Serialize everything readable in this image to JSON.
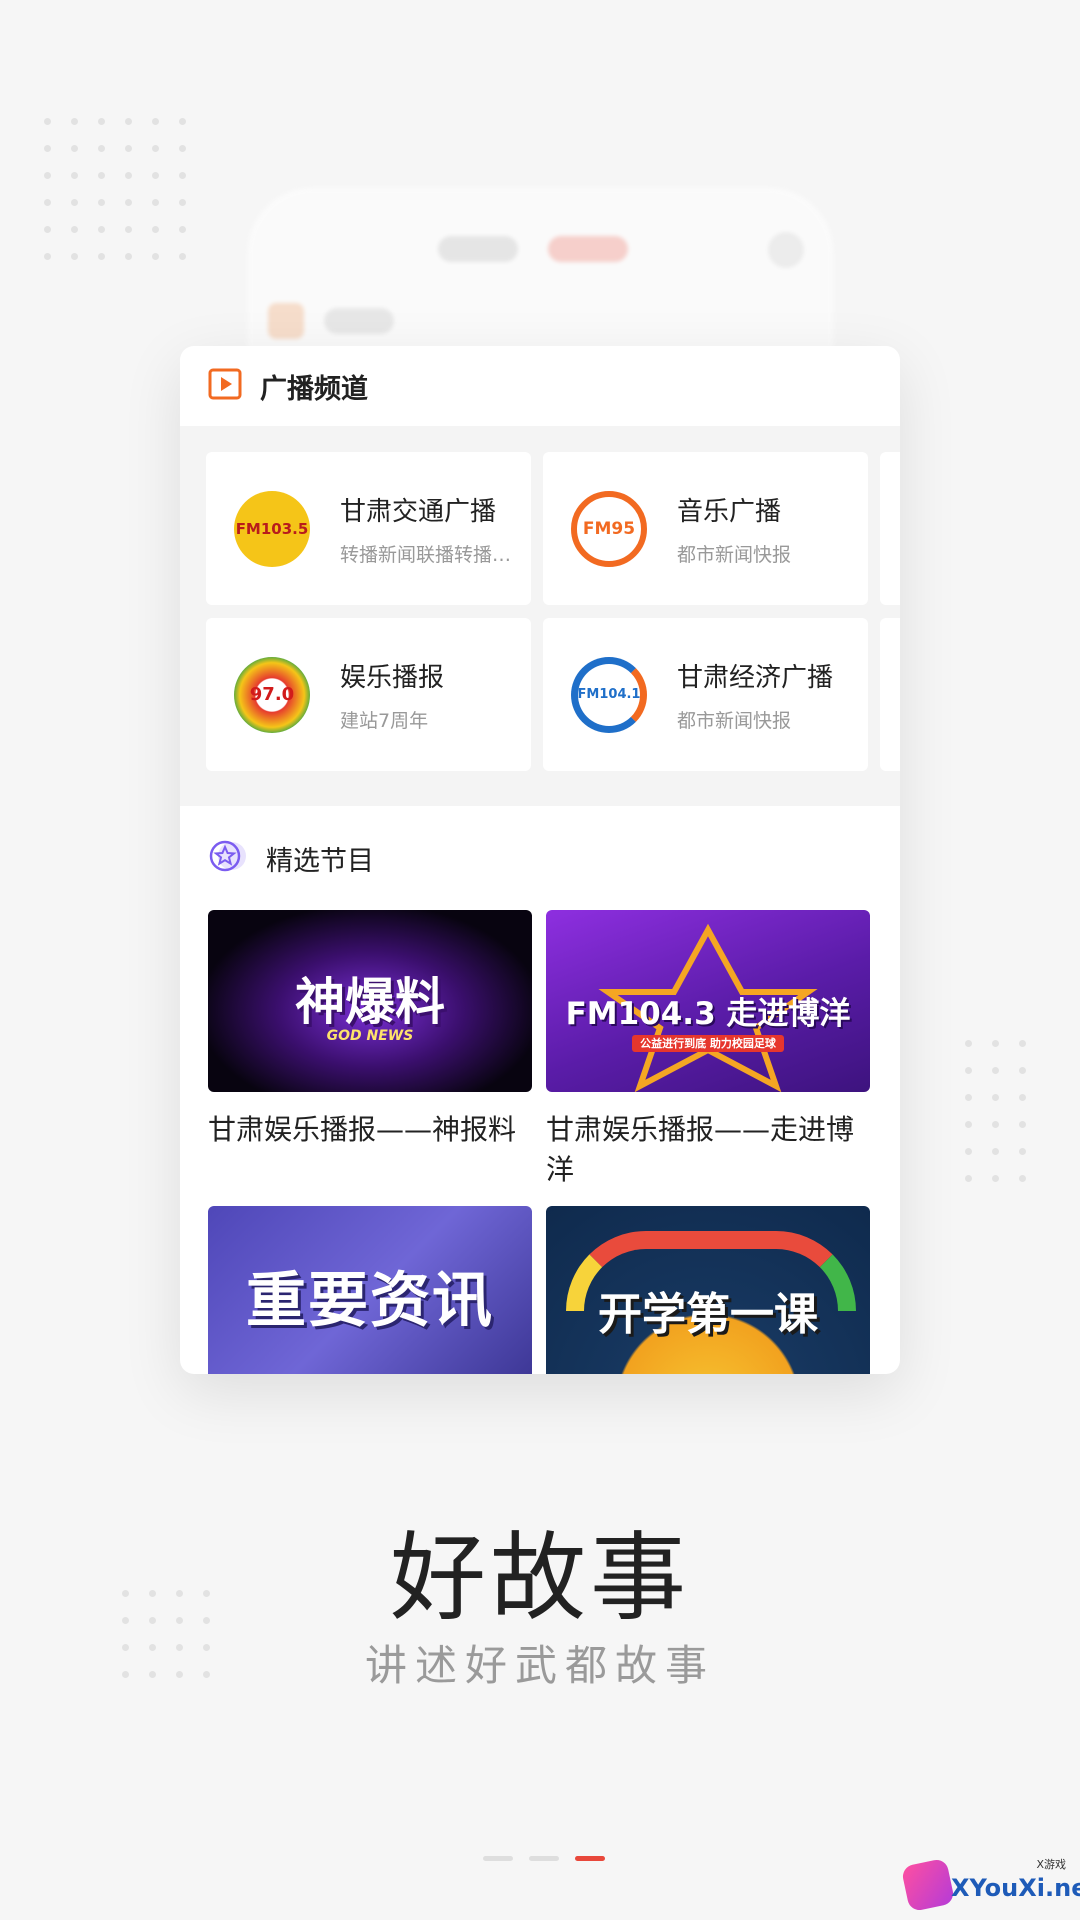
{
  "radio_section": {
    "title": "广播频道",
    "stations": [
      {
        "name": "甘肃交通广播",
        "desc": "转播新闻联播转播新闻联播",
        "logo_icon": "fm1035-logo-icon",
        "logo_text": "FM103.5"
      },
      {
        "name": "音乐广播",
        "desc": "都市新闻快报",
        "logo_icon": "fm95-logo-icon",
        "logo_text": "FM95"
      },
      {
        "name": "娱乐播报",
        "desc": "建站7周年",
        "logo_icon": "fm970-logo-icon",
        "logo_text": "97.0"
      },
      {
        "name": "甘肃经济广播",
        "desc": "都市新闻快报",
        "logo_icon": "fm1041-logo-icon",
        "logo_text": "FM104.1"
      }
    ]
  },
  "featured_section": {
    "title": "精选节目",
    "programs": [
      {
        "title": "甘肃娱乐播报——神报料",
        "thumb_text": "神爆料",
        "thumb_sub": "GOD NEWS"
      },
      {
        "title": "甘肃娱乐播报——走进博洋",
        "thumb_text": "FM104.3 走进博洋",
        "thumb_sub": "公益进行到底  助力校园足球"
      },
      {
        "title": "",
        "thumb_text": "重要资讯",
        "thumb_sub": ""
      },
      {
        "title": "",
        "thumb_text": "开学第一课",
        "thumb_sub": ""
      }
    ]
  },
  "headline": "好故事",
  "subline": "讲述好武都故事",
  "pager": {
    "count": 3,
    "active": 3
  },
  "watermark": {
    "text": "XYouXi.net",
    "small": "X游戏"
  },
  "colors": {
    "accent": "#e8483b",
    "orange": "#f26a21",
    "purple": "#7b5cf0"
  }
}
